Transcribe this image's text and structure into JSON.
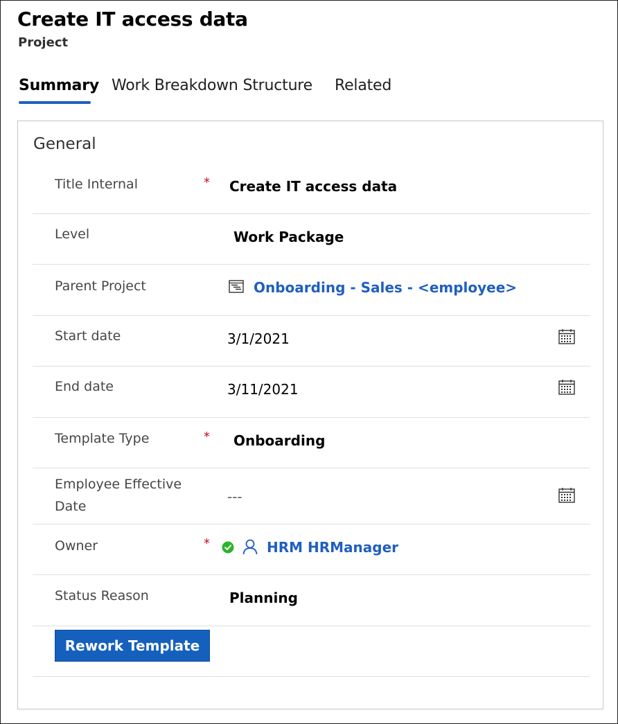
{
  "header": {
    "title": "Create IT access data",
    "subtitle": "Project"
  },
  "tabs": [
    {
      "label": "Summary",
      "active": true
    },
    {
      "label": "Work Breakdown Structure",
      "active": false
    },
    {
      "label": "Related",
      "active": false
    }
  ],
  "section": {
    "title": "General",
    "fields": {
      "title_internal": {
        "label": "Title Internal",
        "required": "*",
        "value": "Create IT access data"
      },
      "level": {
        "label": "Level",
        "value": "Work Package"
      },
      "parent_project": {
        "label": "Parent Project",
        "value": "Onboarding - Sales - <employee>",
        "icon": "project-hierarchy-icon"
      },
      "start_date": {
        "label": "Start date",
        "value": "3/1/2021",
        "icon": "calendar-icon"
      },
      "end_date": {
        "label": "End date",
        "value": "3/11/2021",
        "icon": "calendar-icon"
      },
      "template_type": {
        "label": "Template Type",
        "required": "*",
        "value": "Onboarding"
      },
      "employee_effective_date": {
        "label_line1": "Employee Effective",
        "label_line2": "Date",
        "value": "---",
        "icon": "calendar-icon"
      },
      "owner": {
        "label": "Owner",
        "required": "*",
        "value": "HRM HRManager",
        "icons": [
          "presence-available-icon",
          "person-icon"
        ]
      },
      "status_reason": {
        "label": "Status Reason",
        "value": "Planning"
      }
    },
    "rework_button": "Rework Template"
  },
  "colors": {
    "accent": "#1f5fbf",
    "required": "#c50f1f",
    "button": "#1560bd",
    "presence": "#2db52a"
  }
}
